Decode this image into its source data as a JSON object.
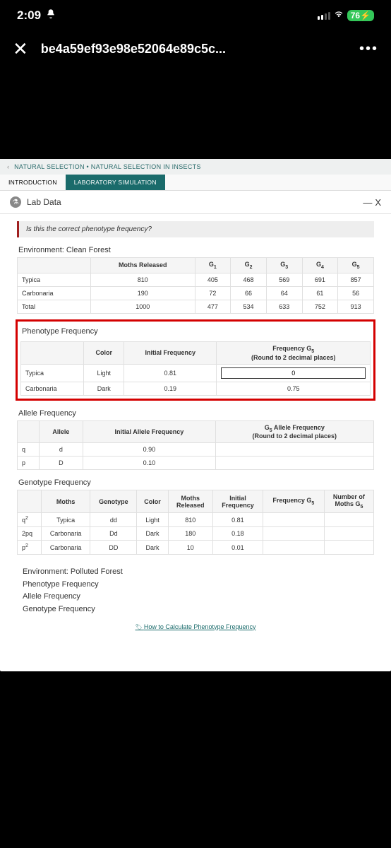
{
  "status": {
    "time": "2:09",
    "battery": "76",
    "bolt": "⚡"
  },
  "browser": {
    "url": "be4a59ef93e98e52064e89c5c..."
  },
  "breadcrumb": "NATURAL SELECTION • NATURAL SELECTION IN INSECTS",
  "tabs": {
    "introduction": "INTRODUCTION",
    "lab_sim": "LABORATORY SIMULATION"
  },
  "panel": {
    "title": "Lab Data",
    "close": "X"
  },
  "alert": "Is this the correct phenotype frequency?",
  "environment": {
    "clean": "Environment: Clean Forest",
    "polluted": "Environment: Polluted Forest"
  },
  "moths_table": {
    "headers": {
      "blank": "",
      "released": "Moths Released",
      "g1": "G₁",
      "g2": "G₂",
      "g3": "G₃",
      "g4": "G₄",
      "g5": "G₅"
    },
    "rows": [
      {
        "label": "Typica",
        "released": "810",
        "g1": "405",
        "g2": "468",
        "g3": "569",
        "g4": "691",
        "g5": "857"
      },
      {
        "label": "Carbonaria",
        "released": "190",
        "g1": "72",
        "g2": "66",
        "g3": "64",
        "g4": "61",
        "g5": "56"
      },
      {
        "label": "Total",
        "released": "1000",
        "g1": "477",
        "g2": "534",
        "g3": "633",
        "g4": "752",
        "g5": "913"
      }
    ]
  },
  "phenotype": {
    "title": "Phenotype Frequency",
    "headers": {
      "blank": "",
      "color": "Color",
      "initial": "Initial Frequency",
      "freq_g5": "Frequency G₅\n(Round to 2 decimal places)"
    },
    "rows": [
      {
        "label": "Typica",
        "color": "Light",
        "initial": "0.81",
        "g5": "0"
      },
      {
        "label": "Carbonaria",
        "color": "Dark",
        "initial": "0.19",
        "g5": "0.75"
      }
    ]
  },
  "allele": {
    "title": "Allele Frequency",
    "headers": {
      "blank": "",
      "allele": "Allele",
      "initial": "Initial Allele Frequency",
      "g5": "G₅ Allele Frequency\n(Round to 2 decimal places)"
    },
    "rows": [
      {
        "label": "q",
        "allele": "d",
        "initial": "0.90",
        "g5": ""
      },
      {
        "label": "p",
        "allele": "D",
        "initial": "0.10",
        "g5": ""
      }
    ]
  },
  "genotype": {
    "title": "Genotype Frequency",
    "headers": {
      "blank": "",
      "moths": "Moths",
      "genotype": "Genotype",
      "color": "Color",
      "released": "Moths\nReleased",
      "initial": "Initial\nFrequency",
      "freq_g5": "Frequency G₅",
      "num_g5": "Number of\nMoths G₅"
    },
    "rows": [
      {
        "sym": "q²",
        "moths": "Typica",
        "genotype": "dd",
        "color": "Light",
        "released": "810",
        "initial": "0.81",
        "g5": "",
        "num": ""
      },
      {
        "sym": "2pq",
        "moths": "Carbonaria",
        "genotype": "Dd",
        "color": "Dark",
        "released": "180",
        "initial": "0.18",
        "g5": "",
        "num": ""
      },
      {
        "sym": "p²",
        "moths": "Carbonaria",
        "genotype": "DD",
        "color": "Dark",
        "released": "10",
        "initial": "0.01",
        "g5": "",
        "num": ""
      }
    ]
  },
  "footer": {
    "pheno": "Phenotype Frequency",
    "allele": "Allele Frequency",
    "geno": "Genotype Frequency",
    "calc_link": "How to Calculate Phenotype Frequency"
  }
}
